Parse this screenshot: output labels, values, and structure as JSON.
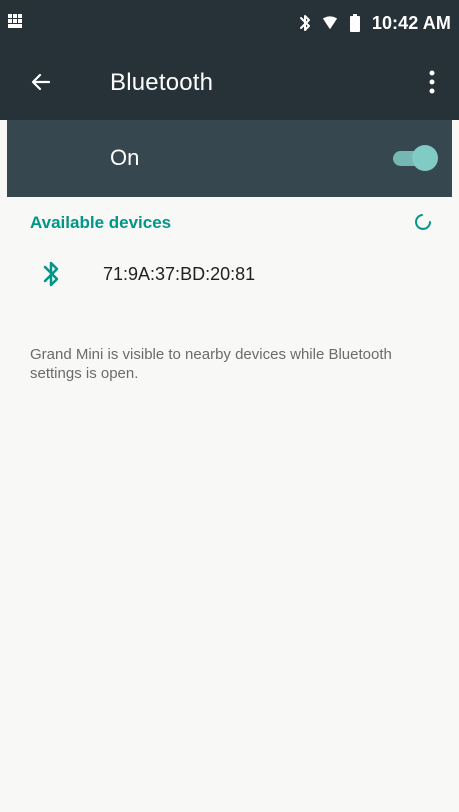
{
  "status_bar": {
    "left_icon": "blackberry-icon",
    "icons": [
      "bluetooth-icon",
      "wifi-icon",
      "battery-icon"
    ],
    "time": "10:42 AM"
  },
  "app_bar": {
    "back_icon": "arrow-left-icon",
    "title": "Bluetooth",
    "menu_icon": "more-vert-icon"
  },
  "bluetooth_switch": {
    "label": "On",
    "state": "on",
    "accent_color": "#80cbc4"
  },
  "available_devices": {
    "header": "Available devices",
    "progress_icon": "loading-spinner-icon",
    "devices": [
      {
        "name": "71:9A:37:BD:20:81",
        "icon": "bluetooth-icon"
      }
    ]
  },
  "visibility_message": "Grand Mini is visible to nearby devices while Bluetooth settings is open.",
  "colors": {
    "status_bar": "#263238",
    "app_bar": "#263238",
    "switch_bar": "#37474f",
    "accent": "#009688",
    "background": "#f8f8f7"
  }
}
